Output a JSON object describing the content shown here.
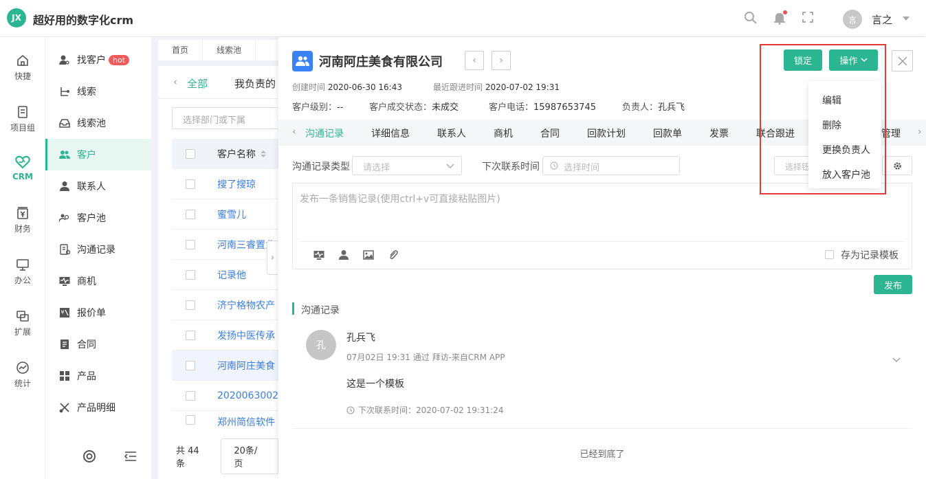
{
  "app": {
    "logo_text": "JX",
    "title": "超好用的数字化crm"
  },
  "topbar": {
    "icons": [
      "search-icon",
      "bell-icon",
      "fullscreen-icon"
    ],
    "user": {
      "avatar_text": "言",
      "name": "言之"
    }
  },
  "rail": [
    {
      "label": "快捷",
      "icon": "home-icon"
    },
    {
      "label": "项目组",
      "icon": "document-icon"
    },
    {
      "label": "CRM",
      "icon": "heart-icon"
    },
    {
      "label": "财务",
      "icon": "yen-box-icon"
    },
    {
      "label": "办公",
      "icon": "monitor-icon"
    },
    {
      "label": "扩展",
      "icon": "extend-icon"
    },
    {
      "label": "统计",
      "icon": "chart-circle-icon"
    }
  ],
  "subnav": {
    "items": [
      {
        "label": "找客户",
        "badge": "hot"
      },
      {
        "label": "线索"
      },
      {
        "label": "线索池"
      },
      {
        "label": "客户"
      },
      {
        "label": "联系人"
      },
      {
        "label": "客户池"
      },
      {
        "label": "沟通记录"
      },
      {
        "label": "商机"
      },
      {
        "label": "报价单"
      },
      {
        "label": "合同"
      },
      {
        "label": "产品"
      },
      {
        "label": "产品明细"
      }
    ]
  },
  "list": {
    "crumbs": [
      "首页",
      "线索池"
    ],
    "tabs": [
      "全部",
      "我负责的"
    ],
    "dept_placeholder": "选择部门或下属",
    "column_header": "客户名称",
    "rows": [
      "搜了搜琼",
      "蜜雪儿",
      "河南三睿置业",
      "记录他",
      "济宁格物农产",
      "发扬中医传承",
      "河南阿庄美食",
      "2020063002",
      "郑州简信软件"
    ],
    "total": "共 44 条",
    "page_size": "20条/页"
  },
  "detail": {
    "company": "河南阿庄美食有限公司",
    "created_label": "创建时间",
    "created": "2020-06-30 16:43",
    "last_follow_label": "最近跟进时间",
    "last_follow": "2020-07-02 19:31",
    "level_label": "客户级别：",
    "level": "--",
    "status_label": "客户成交状态：",
    "status": "未成交",
    "phone_label": "客户电话：",
    "phone": "15987653745",
    "owner_label": "负责人：",
    "owner": "孔兵飞",
    "tabs": [
      "沟通记录",
      "详细信息",
      "联系人",
      "商机",
      "合同",
      "回款计划",
      "回款单",
      "发票",
      "联合跟进",
      "管理"
    ],
    "filter_type_label": "沟通记录类型",
    "filter_type_placeholder": "请选择",
    "filter_next_label": "下次联系时间",
    "filter_next_placeholder": "选择时间",
    "filter_right_placeholder": "选择钮",
    "editor_placeholder": "发布一条销售记录(使用ctrl+v可直接粘贴图片)",
    "save_template": "存为记录模板",
    "publish": "发布",
    "section_title": "沟通记录",
    "record": {
      "avatar_text": "孔",
      "name": "孔兵飞",
      "time": "07月02日 19:31 通过 拜访-来自CRM APP",
      "body": "这是一个模板",
      "next_contact": "下次联系时间：2020-07-02 19:31:24"
    },
    "end_text": "已经到底了"
  },
  "actions": {
    "lock": "锁定",
    "ops": "操作",
    "menu": [
      "编辑",
      "删除",
      "更换负责人",
      "放入客户池"
    ]
  },
  "colors": {
    "accent": "#2bb591",
    "link": "#3b7ddd",
    "highlight": "#e53935"
  }
}
